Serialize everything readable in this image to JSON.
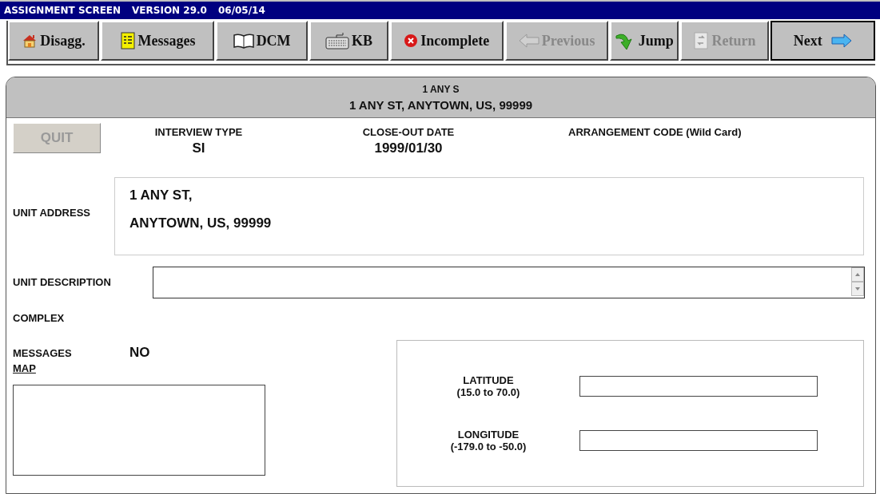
{
  "window": {
    "title": "ASSIGNMENT SCREEN",
    "version": "VERSION 29.0",
    "date": "06/05/14"
  },
  "toolbar": [
    {
      "label": "Disagg.",
      "kind": "house",
      "disabled": false,
      "default": false
    },
    {
      "label": "Messages",
      "kind": "notepad",
      "disabled": false,
      "default": false
    },
    {
      "label": "DCM",
      "kind": "book",
      "disabled": false,
      "default": false
    },
    {
      "label": "KB",
      "kind": "keyboard",
      "disabled": false,
      "default": false
    },
    {
      "label": "Incomplete",
      "kind": "error",
      "disabled": false,
      "default": false
    },
    {
      "label": "Previous",
      "kind": "back",
      "disabled": true,
      "default": false
    },
    {
      "label": "Jump",
      "kind": "jump",
      "disabled": false,
      "default": false
    },
    {
      "label": "Return",
      "kind": "return",
      "disabled": true,
      "default": false
    },
    {
      "label": "Next",
      "kind": "next",
      "disabled": false,
      "default": true
    }
  ],
  "header": {
    "short": "1 ANY S",
    "full": "1 ANY ST, ANYTOWN, US, 99999"
  },
  "quit_button": {
    "label": "QUIT",
    "disabled": true
  },
  "interview_type": {
    "label": "INTERVIEW TYPE",
    "value": "SI"
  },
  "close_out_date": {
    "label": "CLOSE-OUT DATE",
    "value": "1999/01/30"
  },
  "arrangement_code": {
    "label": "ARRANGEMENT CODE (Wild Card)"
  },
  "unit_address": {
    "label": "UNIT ADDRESS",
    "lines": [
      "1 ANY ST,",
      "ANYTOWN, US, 99999"
    ]
  },
  "unit_description": {
    "label": "UNIT DESCRIPTION"
  },
  "complex": {
    "label": "COMPLEX"
  },
  "messages": {
    "label": "MESSAGES",
    "value": "NO"
  },
  "map": {
    "link": "MAP"
  },
  "coordinates": [
    {
      "label": "LATITUDE",
      "range": "(15.0 to 70.0)"
    },
    {
      "label": "LONGITUDE",
      "range": "(-179.0 to -50.0)"
    }
  ]
}
